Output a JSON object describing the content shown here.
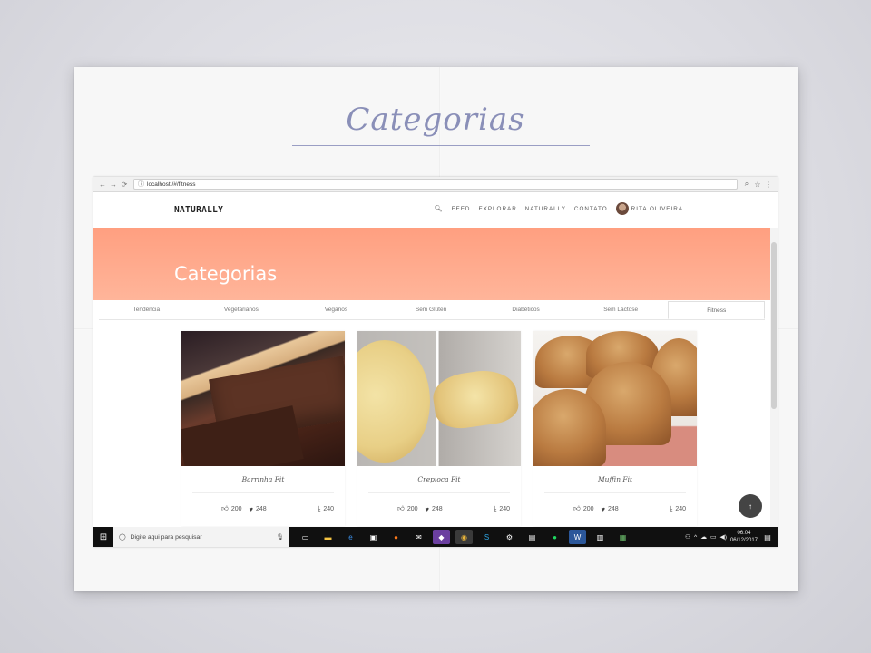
{
  "sheet": {
    "title": "Categorias"
  },
  "browser": {
    "url": "localhost:/#/fitness",
    "nav_icons": [
      "back-icon",
      "forward-icon",
      "reload-icon"
    ],
    "right_icons": [
      "zoom-icon",
      "star-icon",
      "menu-icon"
    ]
  },
  "site": {
    "logo": "NATURALLY",
    "menu": {
      "search_icon": "search-icon",
      "items": [
        "FEED",
        "EXPLORAR",
        "NATURALLY",
        "CONTATO"
      ],
      "user_name": "RITA OLIVEIRA"
    },
    "hero": {
      "title": "Categorias",
      "color": "#ff9f80"
    },
    "tabs": [
      "Tendência",
      "Vegetarianos",
      "Veganos",
      "Sem Glúten",
      "Diabéticos",
      "Sem Lactose",
      "Fitness"
    ],
    "active_tab": "Fitness",
    "cards": [
      {
        "title": "Barrinha Fit",
        "likes": "200",
        "hearts": "248",
        "downloads": "240"
      },
      {
        "title": "Crepioca Fit",
        "likes": "200",
        "hearts": "248",
        "downloads": "240"
      },
      {
        "title": "Muffin Fit",
        "likes": "200",
        "hearts": "248",
        "downloads": "240"
      }
    ],
    "scroll_top_icon": "arrow-up-icon"
  },
  "taskbar": {
    "search_placeholder": "Digite aqui para pesquisar",
    "time": "06:04",
    "date": "06/12/2017"
  }
}
